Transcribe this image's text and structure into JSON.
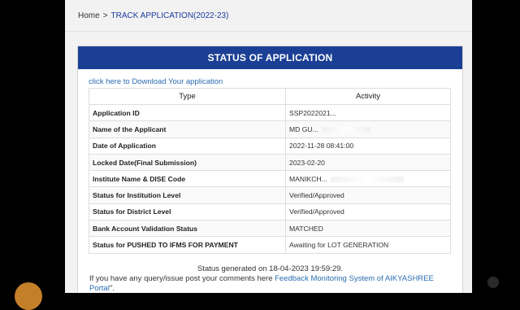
{
  "breadcrumb": {
    "home": "Home",
    "separator": ">",
    "current": "TRACK APPLICATION(2022-23)"
  },
  "panel": {
    "title": "STATUS OF APPLICATION",
    "download_link": "click here to Download Your application",
    "headers": [
      "Type",
      "Activity"
    ],
    "rows": [
      {
        "label": "Application ID",
        "value": "SSP2022021..."
      },
      {
        "label": "Name of the Applicant",
        "value": "MD GU..."
      },
      {
        "label": "Date of Application",
        "value": "2022-11-28 08:41:00"
      },
      {
        "label": "Locked Date(Final Submission)",
        "value": "2023-02-20"
      },
      {
        "label": "Institute Name & DISE Code",
        "value": "MANIKCH..."
      },
      {
        "label": "Status for Institution Level",
        "value": "Verified/Approved"
      },
      {
        "label": "Status for District Level",
        "value": "Verified/Approved"
      },
      {
        "label": "Bank Account Validation Status",
        "value": "MATCHED"
      },
      {
        "label": "Status for PUSHED TO IFMS FOR PAYMENT",
        "value": "Awaiting for LOT GENERATION"
      }
    ]
  },
  "footer": {
    "generated": "Status generated on 18-04-2023 19:59:29.",
    "query_text": "If you have any query/issue post your comments here ",
    "feedback_link": "Feedback Monitoring System of AIKYASHREE Portal",
    "query_end": "\"."
  }
}
